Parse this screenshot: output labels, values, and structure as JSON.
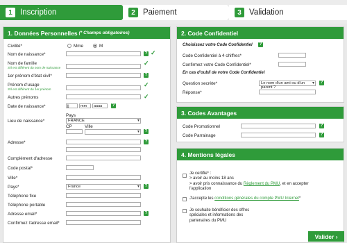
{
  "steps": [
    {
      "num": "1",
      "label": "Inscription"
    },
    {
      "num": "2",
      "label": "Paiement"
    },
    {
      "num": "3",
      "label": "Validation"
    }
  ],
  "personal": {
    "title": "1. Données Personnelles",
    "subtitle": "(* Champs obligatoires)",
    "civilite": "Civilité*",
    "mme": "Mme",
    "m": "M",
    "nom_naissance": "Nom de naissance*",
    "nom_famille": "Nom de famille",
    "nom_famille_note": "S'il est différent du nom de naissance",
    "prenom_civil": "1er prénom d'état civil*",
    "prenom_usage": "Prénom d'usage",
    "prenom_usage_note": "S'il est différent du 1er prénom",
    "autres_prenoms": "Autres prénoms",
    "date_naissance": "Date de naissance*",
    "date_jj": "jj",
    "date_mm": "mm",
    "date_aaaa": "aaaa",
    "lieu_naissance": "Lieu de naissance*",
    "pays_label": "Pays",
    "pays_value": "FRANCE",
    "cp_label": "CP",
    "ville_label": "Ville",
    "adresse": "Adresse*",
    "complement": "Complément d'adresse",
    "code_postal": "Code postal*",
    "ville": "Ville*",
    "pays": "Pays*",
    "pays_select": "France",
    "tel_fixe": "Téléphone fixe",
    "tel_portable": "Téléphone portable",
    "email": "Adresse email*",
    "email_confirm": "Confirmez l'adresse email*"
  },
  "code": {
    "title": "2. Code Confidentiel",
    "hint": "Choisissez votre Code Confidentiel",
    "code_label": "Code Confidentiel à 4 chiffres*",
    "confirm_label": "Confirmez votre Code Confidentiel*",
    "oubli": "En cas d'oubli de votre Code Confidentiel",
    "question_label": "Question secrète*",
    "question_value": "Le nom d'un ami ou d'un parent ?",
    "reponse_label": "Réponse*"
  },
  "avantages": {
    "title": "3. Codes Avantages",
    "promo": "Code Promotionnel",
    "parrainage": "Code Parrainage"
  },
  "legal": {
    "title": "4. Mentions légales",
    "certifie": "Je certifie* :",
    "line1": "> avoir au moins 18 ans",
    "line2a": "> avoir pris connaissance du ",
    "line2link": "Règlement du PMU",
    "line2b": ", et en accepter",
    "line3": "l'application",
    "accept_a": "J'accepte les ",
    "accept_link": "conditions générales du compte PMU Internet",
    "accept_b": "*",
    "offers1": "Je souhaite bénéficier des offres",
    "offers2": "spéciales et informations des",
    "offers3": "partenaires du PMU"
  },
  "help_glyph": "?",
  "check_glyph": "✓",
  "submit": "Valider ›"
}
